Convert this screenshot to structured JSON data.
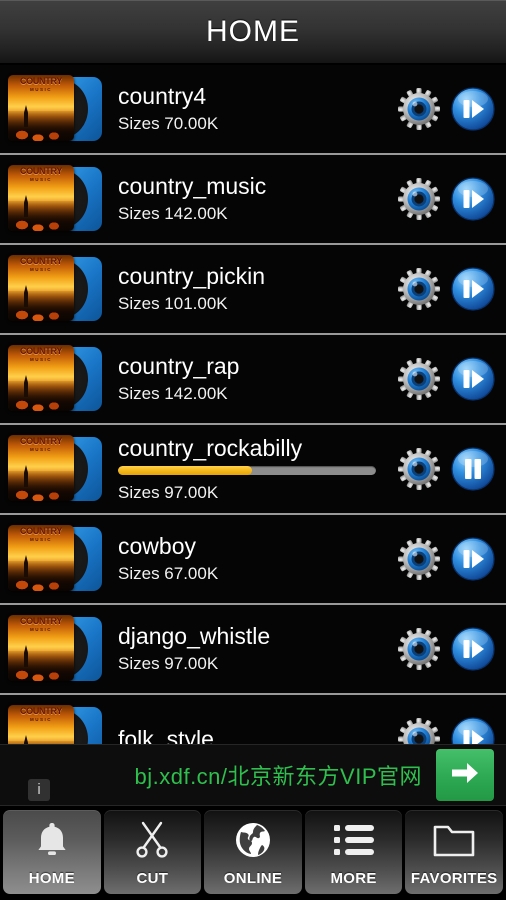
{
  "header": {
    "title": "HOME"
  },
  "list": {
    "size_prefix": "Sizes ",
    "thumbnail": {
      "cover_title": "COUNTRY",
      "cover_subtitle": "MUSIC"
    },
    "rows": [
      {
        "name": "country4",
        "size": "Sizes 70.00K",
        "state": "stopped",
        "action_icon": "play-icon",
        "settings_icon": "gear-icon"
      },
      {
        "name": "country_music",
        "size": "Sizes 142.00K",
        "state": "stopped",
        "action_icon": "play-icon",
        "settings_icon": "gear-icon"
      },
      {
        "name": "country_pickin",
        "size": "Sizes 101.00K",
        "state": "stopped",
        "action_icon": "play-icon",
        "settings_icon": "gear-icon"
      },
      {
        "name": "country_rap",
        "size": "Sizes 142.00K",
        "state": "stopped",
        "action_icon": "play-icon",
        "settings_icon": "gear-icon"
      },
      {
        "name": "country_rockabilly",
        "size": "Sizes 97.00K",
        "state": "playing",
        "action_icon": "pause-icon",
        "settings_icon": "gear-icon",
        "progress_percent": 52
      },
      {
        "name": "cowboy",
        "size": "Sizes 67.00K",
        "state": "stopped",
        "action_icon": "play-icon",
        "settings_icon": "gear-icon"
      },
      {
        "name": "django_whistle",
        "size": "Sizes 97.00K",
        "state": "stopped",
        "action_icon": "play-icon",
        "settings_icon": "gear-icon"
      },
      {
        "name": "folk_style",
        "size": "",
        "state": "stopped",
        "action_icon": "play-icon",
        "settings_icon": "gear-icon"
      }
    ]
  },
  "ad": {
    "text": "bj.xdf.cn/北京新东方VIP官网",
    "cta_icon": "arrow-right-icon",
    "info_badge": "i",
    "text_color": "#2fbf4e",
    "cta_color": "#2faa55"
  },
  "tabbar": {
    "active_index": 0,
    "tabs": [
      {
        "label": "HOME",
        "icon": "bell-icon"
      },
      {
        "label": "CUT",
        "icon": "scissors-icon"
      },
      {
        "label": "ONLINE",
        "icon": "globe-icon"
      },
      {
        "label": "MORE",
        "icon": "list-icon"
      },
      {
        "label": "FAVORITES",
        "icon": "folder-icon"
      }
    ]
  },
  "colors": {
    "accent_blue": "#1a76c8",
    "progress_fill": "#f5b91c",
    "progress_track": "#8d8d8d",
    "background": "#000000",
    "row_separator": "#9a9a9a"
  }
}
